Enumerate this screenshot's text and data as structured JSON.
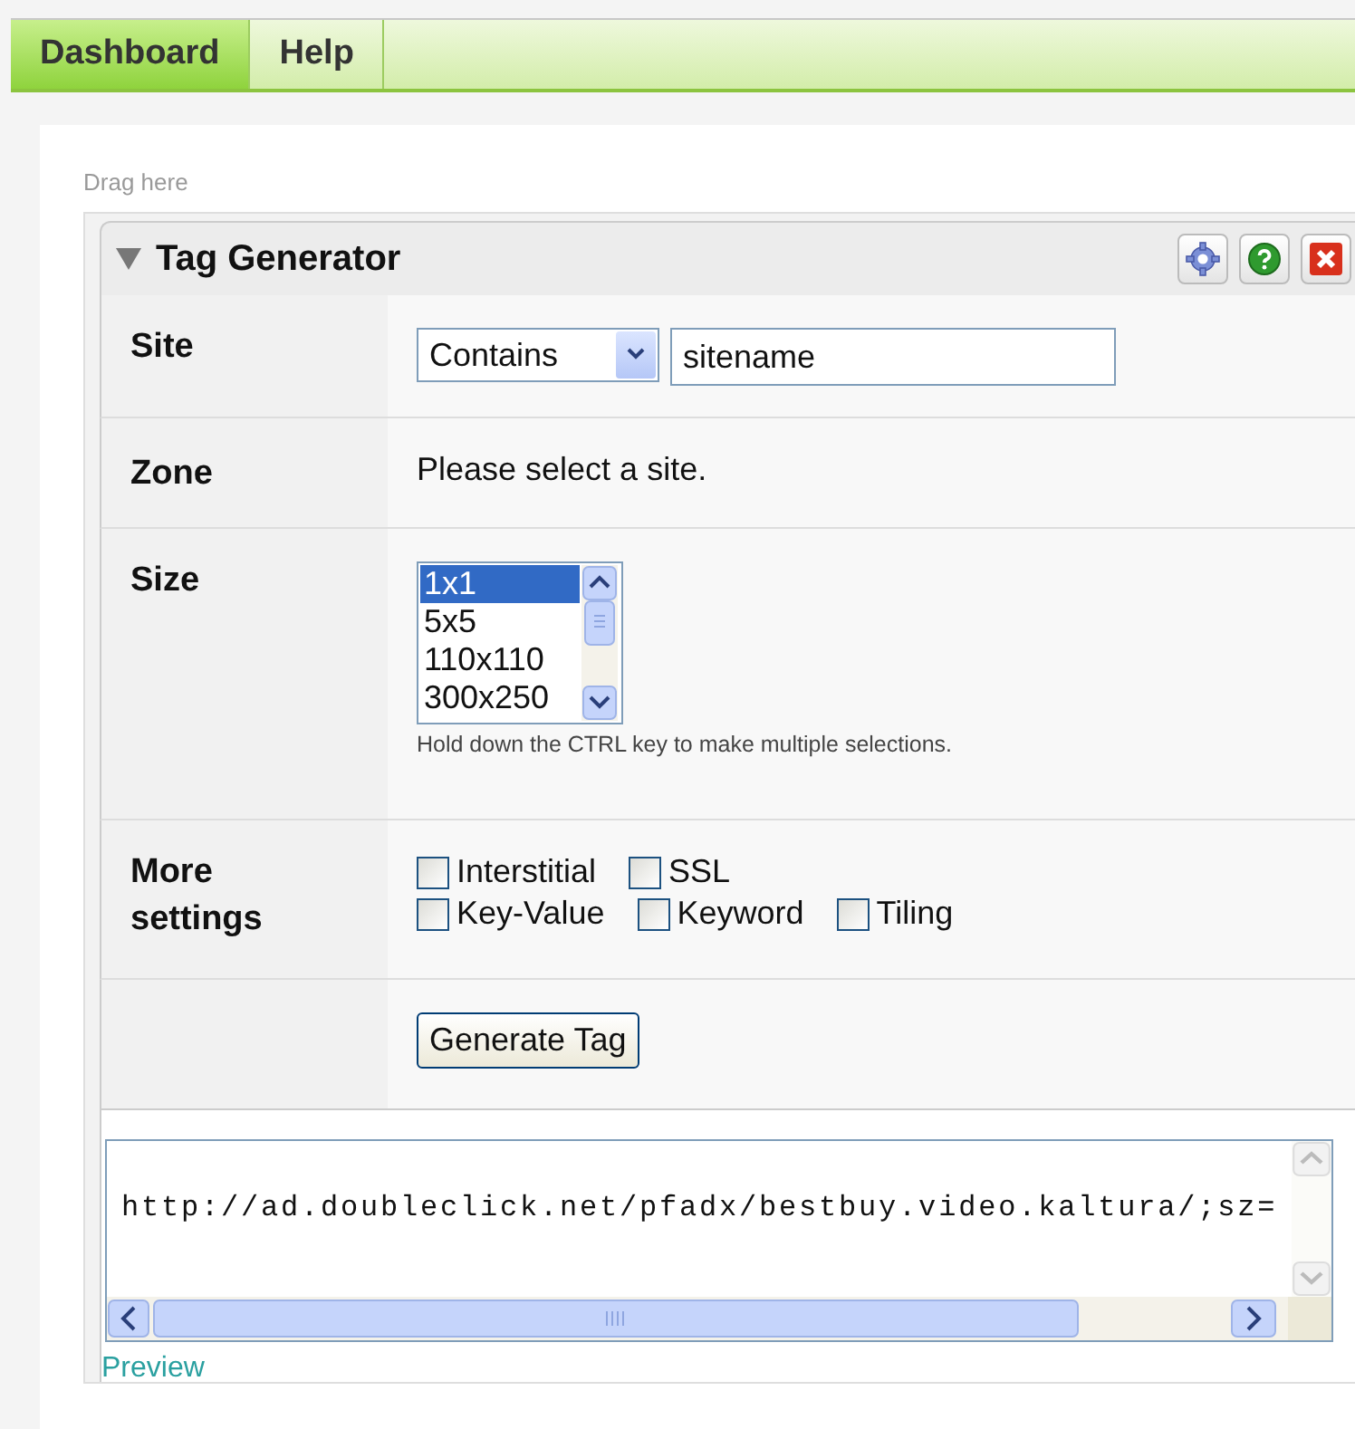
{
  "tabs": [
    {
      "label": "Dashboard",
      "selected": true
    },
    {
      "label": "Help",
      "selected": false
    }
  ],
  "drop_hint": "Drag here",
  "widget": {
    "title": "Tag Generator",
    "expanded": true,
    "site": {
      "label": "Site",
      "operator": "Contains",
      "value": "sitename"
    },
    "zone": {
      "label": "Zone",
      "message": "Please select a site."
    },
    "size": {
      "label": "Size",
      "options": [
        {
          "label": "1x1",
          "selected": true
        },
        {
          "label": "5x5",
          "selected": false
        },
        {
          "label": "110x110",
          "selected": false
        },
        {
          "label": "300x250",
          "selected": false
        }
      ],
      "hint": "Hold down the CTRL key to make multiple selections."
    },
    "settings": {
      "label": "More settings",
      "options": [
        {
          "label": "Interstitial",
          "checked": false
        },
        {
          "label": "SSL",
          "checked": false
        },
        {
          "label": "Key-Value",
          "checked": false
        },
        {
          "label": "Keyword",
          "checked": false
        },
        {
          "label": "Tiling",
          "checked": false
        }
      ]
    },
    "generate_button": "Generate Tag",
    "output": "http://ad.doubleclick.net/pfadx/bestbuy.video.kaltura/;sz=",
    "preview_link": "Preview"
  }
}
